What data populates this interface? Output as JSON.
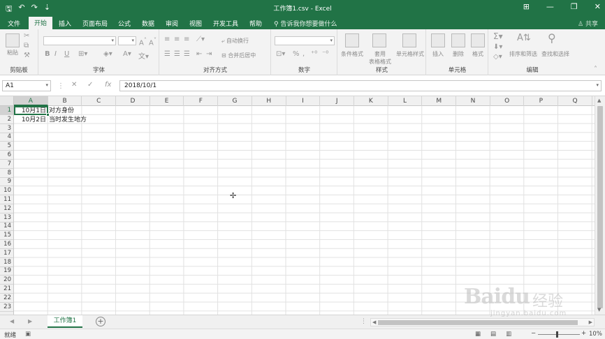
{
  "window": {
    "title": "工作簿1.csv  -  Excel",
    "qat": [
      "save-icon",
      "undo-icon",
      "redo-icon",
      "customize-icon"
    ],
    "controls": [
      "ribbon-display-icon",
      "minimize-icon",
      "restore-icon",
      "close-icon"
    ]
  },
  "tabs": [
    {
      "label": "文件"
    },
    {
      "label": "开始"
    },
    {
      "label": "插入"
    },
    {
      "label": "页面布局"
    },
    {
      "label": "公式"
    },
    {
      "label": "数据"
    },
    {
      "label": "审阅"
    },
    {
      "label": "视图"
    },
    {
      "label": "开发工具"
    },
    {
      "label": "帮助"
    }
  ],
  "active_tab": "开始",
  "tell_me": "告诉我你想要做什么",
  "share": "共享",
  "ribbon": {
    "clipboard": {
      "label": "剪贴板",
      "paste": "粘贴"
    },
    "font": {
      "label": "字体",
      "bold": "B",
      "italic": "I",
      "underline": "U"
    },
    "alignment": {
      "label": "对齐方式",
      "wrap": "自动换行",
      "merge": "合并后居中"
    },
    "number": {
      "label": "数字",
      "percent": "%",
      "comma": ","
    },
    "styles": {
      "label": "样式",
      "conditional": "条件格式",
      "table1": "套用",
      "table2": "表格格式",
      "cell": "单元格样式"
    },
    "cells": {
      "label": "单元格",
      "insert": "插入",
      "delete": "删除",
      "format": "格式"
    },
    "editing": {
      "label": "编辑",
      "sort": "排序和筛选",
      "find": "查找和选择"
    }
  },
  "formula_bar": {
    "name_box": "A1",
    "fx": "fx",
    "value": "2018/10/1"
  },
  "columns": [
    "A",
    "B",
    "C",
    "D",
    "E",
    "F",
    "G",
    "H",
    "I",
    "J",
    "K",
    "L",
    "M",
    "N",
    "O",
    "P",
    "Q"
  ],
  "rows": [
    "1",
    "2",
    "3",
    "4",
    "5",
    "6",
    "7",
    "8",
    "9",
    "10",
    "11",
    "12",
    "13",
    "14",
    "15",
    "16",
    "17",
    "18",
    "19",
    "20",
    "21",
    "22",
    "23"
  ],
  "cells": {
    "A1": "10月1日",
    "B1": "对方身份",
    "A2": "10月2日",
    "B2": "当时发生地方"
  },
  "sheet_tab": "工作簿1",
  "status": {
    "ready": "就绪",
    "zoom": "10%"
  },
  "watermark": {
    "brand": "Baidu",
    "cn": "经验",
    "url": "jingyan.baidu.com"
  },
  "colors": {
    "accent": "#217346"
  }
}
